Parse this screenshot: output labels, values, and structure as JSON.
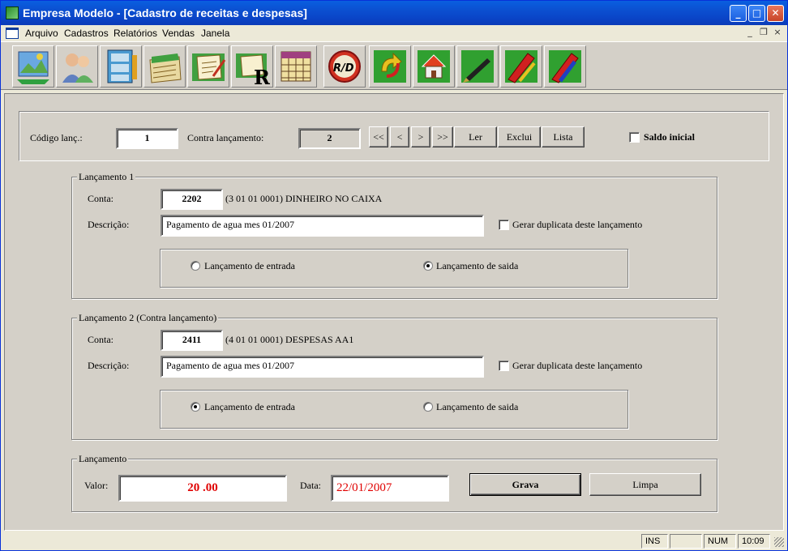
{
  "window": {
    "title": "Empresa Modelo - [Cadastro de receitas e despesas]",
    "minimize": "_",
    "maximize": "□",
    "close": "✕"
  },
  "menu": {
    "items": [
      "Arquivo",
      "Cadastros",
      "Relatórios",
      "Vendas",
      "Janela"
    ],
    "mdi_minimize": "_",
    "mdi_restore": "❐",
    "mdi_close": "×"
  },
  "toolbar": {
    "r_glyph": "R",
    "rd_glyph": "R/D",
    "buttons": [
      "map-icon",
      "clients-icon",
      "cabinet-icon",
      "folders-icon",
      "document-edit-icon",
      "document-report-icon",
      "calendar-grid-icon",
      "rd-icon",
      "refresh-icon",
      "home-icon",
      "pen-icon",
      "red-pencil-icon",
      "blue-pencil-icon"
    ]
  },
  "header": {
    "codigo_label": "Código lanç.:",
    "codigo_value": "1",
    "contra_label": "Contra lançamento:",
    "contra_value": "2",
    "nav_first": "<<",
    "nav_prev": "<",
    "nav_next": ">",
    "nav_last": ">>",
    "ler": "Ler",
    "exclui": "Exclui",
    "lista": "Lista",
    "saldo_inicial": "Saldo inicial",
    "saldo_checked": false
  },
  "lanc1": {
    "title": "Lançamento 1",
    "conta_label": "Conta:",
    "conta_value": "2202",
    "conta_desc": "(3 01 01 0001) DINHEIRO NO CAIXA",
    "descricao_label": "Descrição:",
    "descricao_value": "Pagamento de agua mes 01/2007",
    "duplicata": "Gerar duplicata deste lançamento",
    "entrada": "Lançamento de entrada",
    "saida": "Lançamento de saida",
    "selected": "saida"
  },
  "lanc2": {
    "title": "Lançamento 2 (Contra lançamento)",
    "conta_label": "Conta:",
    "conta_value": "2411",
    "conta_desc": "(4 01 01 0001) DESPESAS AA1",
    "descricao_label": "Descrição:",
    "descricao_value": "Pagamento de agua mes 01/2007",
    "duplicata": "Gerar duplicata deste lançamento",
    "entrada": "Lançamento de entrada",
    "saida": "Lançamento de saida",
    "selected": "entrada"
  },
  "lancamento": {
    "title": "Lançamento",
    "valor_label": "Valor:",
    "valor_value": "20 .00",
    "data_label": "Data:",
    "data_value": "22/01/2007",
    "grava": "Grava",
    "limpa": "Limpa"
  },
  "status": {
    "ins": "INS",
    "blank": "",
    "num": "NUM",
    "time": "10:09"
  }
}
